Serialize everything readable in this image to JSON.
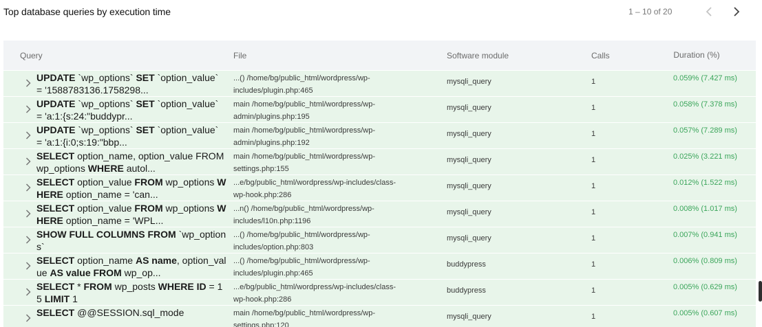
{
  "title": "Top database queries by execution time",
  "pager": {
    "range": "1 – 10 of 20",
    "prev_icon": "chevron-left-icon",
    "next_icon": "chevron-right-icon"
  },
  "columns": {
    "query": "Query",
    "file": "File",
    "module": "Software module",
    "calls": "Calls",
    "duration": "Duration (%)"
  },
  "colors": {
    "row_bg": "#e8f5ea",
    "header_bg": "#f2f4f6",
    "duration_text": "#3aa55a"
  },
  "rows": [
    {
      "query": [
        [
          "b",
          "UPDATE"
        ],
        [
          "t",
          " `wp_options` "
        ],
        [
          "b",
          "SET"
        ],
        [
          "t",
          " `option_value` = '1588783136.1758298..."
        ]
      ],
      "file": "...() /home/bg/public_html/wordpress/wp-includes/plugin.php:465",
      "module": "mysqli_query",
      "calls": "1",
      "duration": "0.059% (7.427 ms)"
    },
    {
      "query": [
        [
          "b",
          "UPDATE"
        ],
        [
          "t",
          " `wp_options` "
        ],
        [
          "b",
          "SET"
        ],
        [
          "t",
          " `option_value` = 'a:1:{s:24:\"buddypr..."
        ]
      ],
      "file": "main /home/bg/public_html/wordpress/wp-admin/plugins.php:195",
      "module": "mysqli_query",
      "calls": "1",
      "duration": "0.058% (7.378 ms)"
    },
    {
      "query": [
        [
          "b",
          "UPDATE"
        ],
        [
          "t",
          " `wp_options` "
        ],
        [
          "b",
          "SET"
        ],
        [
          "t",
          " `option_value` = 'a:1:{i:0;s:19:\"bbp..."
        ]
      ],
      "file": "main /home/bg/public_html/wordpress/wp-admin/plugins.php:192",
      "module": "mysqli_query",
      "calls": "1",
      "duration": "0.057% (7.289 ms)"
    },
    {
      "query": [
        [
          "b",
          "SELECT"
        ],
        [
          "t",
          " option_name, option_value FROM wp_options "
        ],
        [
          "b",
          "WHERE"
        ],
        [
          "t",
          " autol..."
        ]
      ],
      "file": "main /home/bg/public_html/wordpress/wp-settings.php:155",
      "module": "mysqli_query",
      "calls": "1",
      "duration": "0.025% (3.221 ms)"
    },
    {
      "query": [
        [
          "b",
          "SELECT"
        ],
        [
          "t",
          " option_value "
        ],
        [
          "b",
          "FROM"
        ],
        [
          "t",
          " wp_options "
        ],
        [
          "b",
          "WHERE"
        ],
        [
          "t",
          " option_name = 'can..."
        ]
      ],
      "file": "...e/bg/public_html/wordpress/wp-includes/class-wp-hook.php:286",
      "module": "mysqli_query",
      "calls": "1",
      "duration": "0.012% (1.522 ms)"
    },
    {
      "query": [
        [
          "b",
          "SELECT"
        ],
        [
          "t",
          " option_value "
        ],
        [
          "b",
          "FROM"
        ],
        [
          "t",
          " wp_options "
        ],
        [
          "b",
          "WHERE"
        ],
        [
          "t",
          " option_name = 'WPL..."
        ]
      ],
      "file": "...n() /home/bg/public_html/wordpress/wp-includes/l10n.php:1196",
      "module": "mysqli_query",
      "calls": "1",
      "duration": "0.008% (1.017 ms)"
    },
    {
      "query": [
        [
          "b",
          "SHOW FULL COLUMNS FROM"
        ],
        [
          "t",
          " `wp_options`"
        ]
      ],
      "file": "...() /home/bg/public_html/wordpress/wp-includes/option.php:803",
      "module": "mysqli_query",
      "calls": "1",
      "duration": "0.007% (0.941 ms)"
    },
    {
      "query": [
        [
          "b",
          "SELECT"
        ],
        [
          "t",
          " option_name "
        ],
        [
          "b",
          "AS name"
        ],
        [
          "t",
          ", option_value "
        ],
        [
          "b",
          "AS value FROM"
        ],
        [
          "t",
          " wp_op..."
        ]
      ],
      "file": "...() /home/bg/public_html/wordpress/wp-includes/plugin.php:465",
      "module": "buddypress",
      "calls": "1",
      "duration": "0.006% (0.809 ms)"
    },
    {
      "query": [
        [
          "b",
          "SELECT"
        ],
        [
          "t",
          " * "
        ],
        [
          "b",
          "FROM"
        ],
        [
          "t",
          " wp_posts "
        ],
        [
          "b",
          "WHERE ID"
        ],
        [
          "t",
          " = 15 "
        ],
        [
          "b",
          "LIMIT"
        ],
        [
          "t",
          " 1"
        ]
      ],
      "file": "...e/bg/public_html/wordpress/wp-includes/class-wp-hook.php:286",
      "module": "buddypress",
      "calls": "1",
      "duration": "0.005% (0.629 ms)"
    },
    {
      "query": [
        [
          "b",
          "SELECT"
        ],
        [
          "t",
          " @@SESSION.sql_mode"
        ]
      ],
      "file": "main /home/bg/public_html/wordpress/wp-settings.php:120",
      "module": "mysqli_query",
      "calls": "1",
      "duration": "0.005% (0.607 ms)"
    }
  ]
}
